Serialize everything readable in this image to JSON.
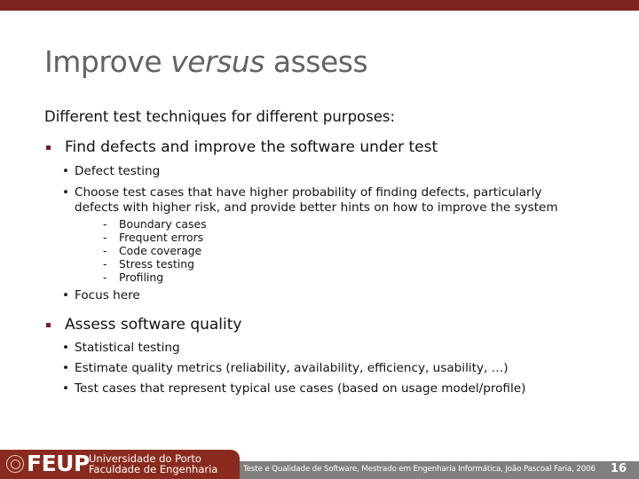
{
  "slide": {
    "title_parts": [
      "Improve ",
      "versus",
      " assess"
    ],
    "intro": "Different test techniques for different purposes:",
    "sections": [
      {
        "heading": "Find defects and improve the software under test",
        "items": [
          {
            "text": "Defect testing"
          },
          {
            "text_lines": [
              "Choose test cases that have higher probability of finding defects, particularly",
              "defects with higher risk, and provide better hints on how to improve the system"
            ],
            "subitems": [
              "Boundary cases",
              "Frequent errors",
              "Code coverage",
              "Stress testing",
              "Profiling"
            ]
          },
          {
            "text": "Focus here"
          }
        ]
      },
      {
        "heading": "Assess software quality",
        "items": [
          {
            "text": "Statistical testing"
          },
          {
            "text": "Estimate quality metrics (reliability, availability, efficiency, usability, …)"
          },
          {
            "text": "Test cases that represent typical use cases (based on usage model/profile)"
          }
        ]
      }
    ]
  },
  "markers": {
    "level1": "square-bullet-icon",
    "level2": "•",
    "level3": "-"
  },
  "footer": {
    "logo_acronym": "FEUP",
    "logo_line1": "Universidade do Porto",
    "logo_line2": "Faculdade de Engenharia",
    "course_text": "Teste e Qualidade de Software, Mestrado em Engenharia Informática, João Pascoal Faria, 2006",
    "page_number": "16"
  },
  "colors": {
    "top_bar": "#7e231e",
    "title": "#636363",
    "bullet": "#7a1a38",
    "footer_red": "#8a2a1e",
    "footer_gray": "#7f7f7f"
  }
}
